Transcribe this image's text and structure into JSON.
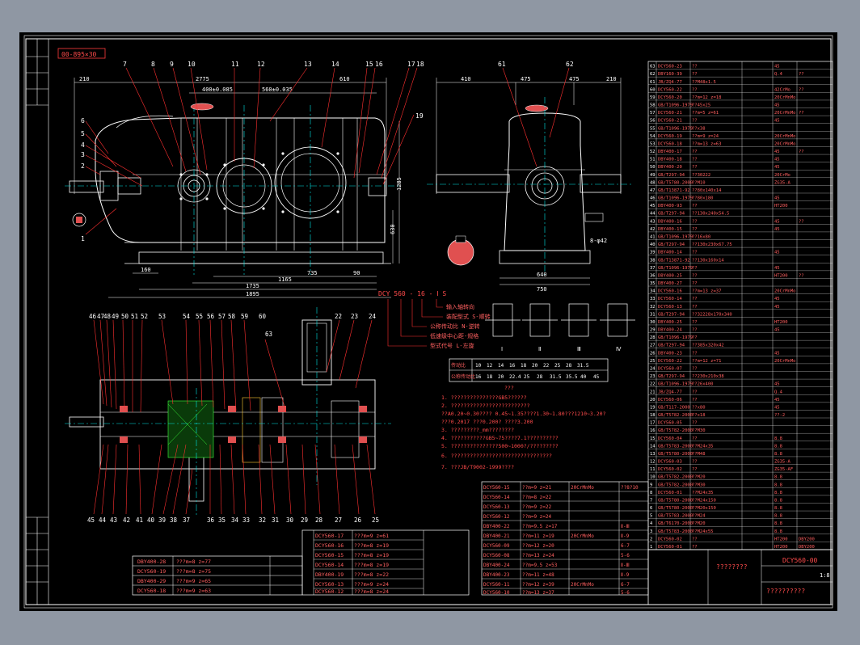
{
  "drawing": {
    "code_box": "00-895×30",
    "title_block": {
      "title": "????????",
      "drawing_no": "DCY560-00",
      "company": "??????????",
      "scale": "1:8"
    },
    "top_callouts": [
      "7",
      "8",
      "9",
      "10",
      "11",
      "12",
      "13",
      "14",
      "15",
      "16",
      "17",
      "18"
    ],
    "left_callouts": [
      "6",
      "5",
      "4",
      "3",
      "2",
      "1"
    ],
    "right_callout": "19",
    "side_callouts": [
      "61",
      "62"
    ],
    "dims_top": {
      "d210": "210",
      "d2775": "2775",
      "d400": "400±0.085",
      "d560": "560±0.035",
      "d610": "610",
      "d410": "410",
      "d475a": "475",
      "d475b": "475",
      "d210b": "210",
      "d1735": "1735",
      "d1165": "1165",
      "d1895": "1895",
      "d735": "735",
      "d160": "160",
      "d90": "90",
      "d640": "640",
      "d750": "750",
      "d1285": "1285",
      "d630": "630",
      "dphi": "8-φ42"
    },
    "model_label": "DCY 560 - 16 - Ⅰ S",
    "model_legend": [
      "输入轴转向",
      "装配型式 S-顺转",
      "公称传动比 N-逆转",
      "低速级中心距-规格",
      "型式代号 L-左旋"
    ],
    "assembly_roman": [
      "Ⅰ",
      "Ⅱ",
      "Ⅲ",
      "Ⅳ"
    ],
    "ratio_table": {
      "row1": [
        "传动比",
        "10",
        "12",
        "14",
        "16",
        "18",
        "20",
        "22",
        "25",
        "28",
        "31.5",
        "35.5",
        "40",
        "45",
        "50"
      ],
      "row2": [
        "公称传动比",
        "16",
        "18",
        "20",
        "22.4",
        "25",
        "28",
        "31.5",
        "35.5",
        "40",
        "45",
        "50"
      ]
    },
    "notes_title": "???",
    "notes": [
      "1. ???????????????GB5??????",
      "2. ?????????????????????????",
      "   ??A0.20~0.30???? 0.45~1.35????1.30~1.80???1210~3.20?",
      "   ???0.2017  ???0.200?  ????3.200",
      "3. ?????????_mm????????",
      "4. ???????????GB5~75????7.1??????????",
      "5. ???????????????500~1000?/?????????",
      "6. ????????????????????????????????",
      "7. ???JB/T9002-1999????"
    ],
    "bottom_callouts": [
      "45",
      "44",
      "43",
      "42",
      "41",
      "40",
      "39",
      "38",
      "37",
      "36",
      "35",
      "34",
      "33",
      "32",
      "31",
      "30",
      "29",
      "28",
      "27",
      "26",
      "25"
    ],
    "mid_callouts": [
      "46",
      "47",
      "48",
      "49",
      "50",
      "51",
      "52",
      "53",
      "54",
      "55",
      "56",
      "57",
      "58",
      "59",
      "60",
      "22",
      "23",
      "24",
      "63"
    ],
    "gear_table_left": [
      [
        "DBY400-28",
        "???m=8 z=77",
        "",
        ""
      ],
      [
        "DCY560-19",
        "???m=8 z=75",
        "",
        ""
      ],
      [
        "DBY400-29",
        "???m=9 z=65",
        "",
        ""
      ],
      [
        "DCY560-18",
        "???m=9 z=63",
        "",
        ""
      ]
    ],
    "gear_table_mid": [
      [
        "DCY560-17",
        "???m=9 z=61"
      ],
      [
        "DCY560-16",
        "???m=8 z=19"
      ],
      [
        "DCY560-15",
        "???m=8 z=19"
      ],
      [
        "DCY560-14",
        "???m=8 z=19"
      ],
      [
        "DBY400-19",
        "???m=8 z=22"
      ],
      [
        "DCY560-13",
        "???m=9 z=24"
      ],
      [
        "DCY560-12",
        "???m=8 z=24"
      ]
    ],
    "gear_table_right": [
      [
        "DCY560-15",
        "??m=9 z=21",
        "20CrMnMo",
        "??8?10"
      ],
      [
        "DCY560-14",
        "??m=8 z=22",
        "",
        ""
      ],
      [
        "DCY560-13",
        "??m=9 z=22",
        "",
        ""
      ],
      [
        "DCY560-12",
        "??m=9 z=24",
        "",
        ""
      ],
      [
        "DBY400-22",
        "??m=9.5 z=17",
        "",
        "Ⅱ-Ⅲ"
      ],
      [
        "DBY400-21",
        "??m=11 z=19",
        "20CrMnMo",
        "Ⅱ-9"
      ],
      [
        "DCY560-09",
        "??m=12 z=20",
        "",
        "6-7"
      ],
      [
        "DCY560-08",
        "??m=13 z=24",
        "",
        "5-6"
      ],
      [
        "DBY400-24",
        "??m=9.5 z=53",
        "",
        "Ⅱ-Ⅲ"
      ],
      [
        "DBY400-23",
        "??m=11 z=48",
        "",
        "Ⅱ-9"
      ],
      [
        "DCY560-11",
        "??m=12 z=39",
        "20CrMnMo",
        "6-7"
      ],
      [
        "DCY560-10",
        "??m=13 z=37",
        "",
        "5-6"
      ]
    ],
    "bom": [
      [
        "63",
        "DCY560-23",
        "??",
        "",
        "45",
        ""
      ],
      [
        "62",
        "DBY160-39",
        "??",
        "",
        "Q.4",
        "??"
      ],
      [
        "61",
        "JB/ZQ4-77",
        "??M48x1.5",
        "",
        "",
        ""
      ],
      [
        "60",
        "DCY560-22",
        "??",
        "",
        "42CrMo",
        "??"
      ],
      [
        "59",
        "DCY560-20",
        "??m=12 z=18",
        "",
        "20CrMnMo",
        ""
      ],
      [
        "58",
        "GB/T1096-1979",
        "??45x25",
        "",
        "45",
        ""
      ],
      [
        "57",
        "DCY560-21",
        "??m=5 z=61",
        "",
        "20CrMnMo",
        "??"
      ],
      [
        "56",
        "DCY560-21",
        "??",
        "",
        "45",
        ""
      ],
      [
        "55",
        "GB/T1096-1979",
        "??x38",
        "",
        "",
        ""
      ],
      [
        "54",
        "DCY560-19",
        "??m=9 z=24",
        "",
        "20CrMnMo",
        ""
      ],
      [
        "53",
        "DCY560-18",
        "??m=13 z=63",
        "",
        "20CrMnMo",
        ""
      ],
      [
        "52",
        "DBY400-17",
        "??",
        "",
        "45",
        "??"
      ],
      [
        "51",
        "DBY400-18",
        "??",
        "",
        "45",
        ""
      ],
      [
        "50",
        "DBY400-20",
        "??",
        "",
        "45",
        ""
      ],
      [
        "49",
        "GB/T297-94",
        "??30222",
        "",
        "20CrMo",
        ""
      ],
      [
        "48",
        "GB/T5780-2000",
        "??M10",
        "",
        "ZG35-A",
        ""
      ],
      [
        "47",
        "GB/T13871-92",
        "??80x140x14",
        "",
        "",
        ""
      ],
      [
        "46",
        "GB/T1096-1979",
        "??80x180",
        "",
        "45",
        ""
      ],
      [
        "45",
        "DBY400-93",
        "??",
        "",
        "HT200",
        ""
      ],
      [
        "44",
        "GB/T297-94",
        "??130x240x54.5",
        "",
        "",
        ""
      ],
      [
        "43",
        "DBY400-16",
        "??",
        "",
        "45",
        "??"
      ],
      [
        "42",
        "DBY400-15",
        "??",
        "",
        "45",
        ""
      ],
      [
        "41",
        "GB/T1096-1979",
        "??16x80",
        "",
        "",
        ""
      ],
      [
        "40",
        "GB/T297-94",
        "??130x230x67.75",
        "",
        "",
        ""
      ],
      [
        "39",
        "DBY400-14",
        "??",
        "",
        "45",
        ""
      ],
      [
        "38",
        "GB/T13871-92",
        "??130x160x14",
        "",
        "",
        ""
      ],
      [
        "37",
        "GB/T1096-1979",
        "??",
        "",
        "45",
        ""
      ],
      [
        "36",
        "DBY400-25",
        "??",
        "",
        "HT200",
        "??"
      ],
      [
        "35",
        "DBY400-27",
        "??",
        "",
        "",
        ""
      ],
      [
        "34",
        "DCY560-16",
        "??m=13 z=37",
        "",
        "20CrMnMo",
        ""
      ],
      [
        "33",
        "DCY560-14",
        "??",
        "",
        "45",
        ""
      ],
      [
        "32",
        "DCY560-13",
        "??",
        "",
        "45",
        ""
      ],
      [
        "31",
        "GB/T297-94",
        "??32228x170x340",
        "",
        "",
        ""
      ],
      [
        "30",
        "DBY400-25",
        "??",
        "",
        "HT200",
        ""
      ],
      [
        "29",
        "DBY400-24",
        "??",
        "",
        "45",
        ""
      ],
      [
        "28",
        "GB/T1096-1979",
        "??",
        "",
        "",
        ""
      ],
      [
        "27",
        "GB/T297-94",
        "??385x320x42",
        "",
        "",
        ""
      ],
      [
        "26",
        "DBY400-23",
        "??",
        "",
        "45",
        ""
      ],
      [
        "25",
        "DCY560-22",
        "??m=12 z=71",
        "",
        "20CrMnMo",
        ""
      ],
      [
        "24",
        "DCY560-07",
        "??",
        "",
        "",
        ""
      ],
      [
        "23",
        "GB/T297-94",
        "??230x210x38",
        "",
        "",
        ""
      ],
      [
        "22",
        "GB/T1096-1979",
        "??26x400",
        "",
        "45",
        ""
      ],
      [
        "21",
        "JB/ZQ4-77",
        "??",
        "",
        "Q.4",
        ""
      ],
      [
        "20",
        "DCY560-06",
        "??",
        "",
        "45",
        ""
      ],
      [
        "19",
        "GB/T117-2000",
        "??x80",
        "",
        "45",
        ""
      ],
      [
        "18",
        "GB/T5782-2000",
        "??x18",
        "",
        "??-2",
        ""
      ],
      [
        "17",
        "DCY560-05",
        "??",
        "",
        "",
        ""
      ],
      [
        "16",
        "GB/T5782-2000",
        "??M30",
        "",
        "",
        ""
      ],
      [
        "15",
        "DCY560-04",
        "??",
        "",
        "8.8",
        ""
      ],
      [
        "14",
        "GB/T5783-2000",
        "??M24x35",
        "",
        "8.8",
        ""
      ],
      [
        "13",
        "GB/T5780-2000",
        "??M48",
        "",
        "8.8",
        ""
      ],
      [
        "12",
        "DCY560-03",
        "??",
        "",
        "ZG35-A",
        ""
      ],
      [
        "11",
        "DCY560-02",
        "??",
        "",
        "ZG35-AF",
        ""
      ],
      [
        "10",
        "GB/T5782-2000",
        "??M20",
        "",
        "8.8",
        ""
      ],
      [
        "9",
        "GB/T5782-2000",
        "??M30",
        "",
        "8.8",
        ""
      ],
      [
        "8",
        "DCY560-01",
        "??M24x35",
        "",
        "8.8",
        ""
      ],
      [
        "7",
        "GB/T5780-2000",
        "??M24x150",
        "",
        "8.8",
        ""
      ],
      [
        "6",
        "GB/T5780-2000",
        "??M20x150",
        "",
        "8.8",
        ""
      ],
      [
        "5",
        "GB/T5783-2000",
        "??M24",
        "",
        "8.8",
        ""
      ],
      [
        "4",
        "GB/T6170-2000",
        "??M20",
        "",
        "8.8",
        ""
      ],
      [
        "3",
        "GB/T5783-2000",
        "??M24x55",
        "",
        "8.8",
        ""
      ],
      [
        "2",
        "DCY560-02",
        "??",
        "",
        "HT200",
        "DBY200"
      ],
      [
        "1",
        "DCY560-01",
        "??",
        "",
        "HT200",
        "DBY200"
      ]
    ]
  }
}
